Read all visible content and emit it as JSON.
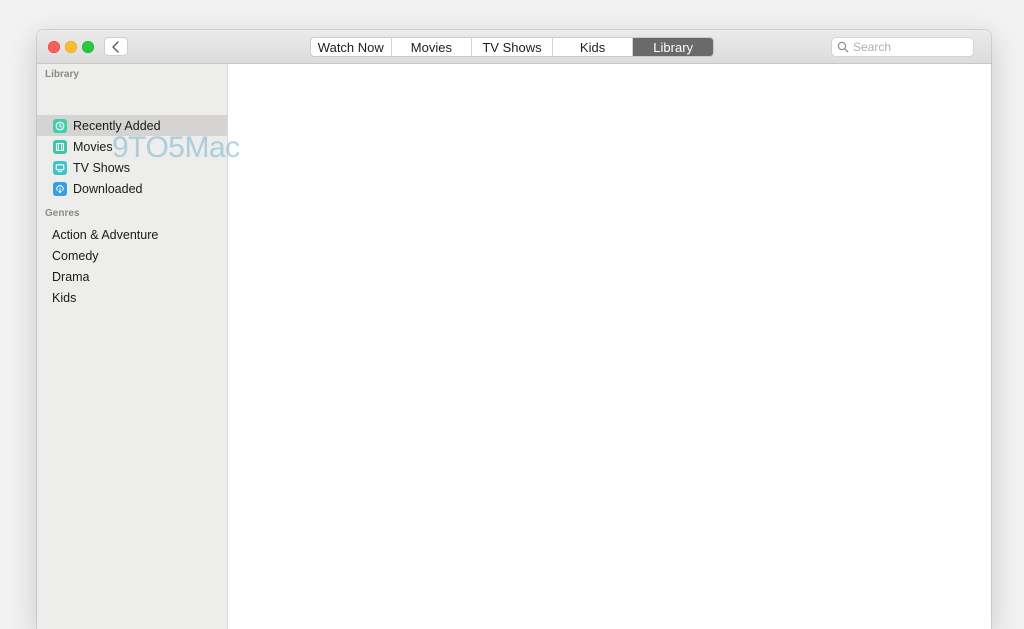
{
  "toolbar": {
    "tabs": [
      {
        "label": "Watch Now"
      },
      {
        "label": "Movies"
      },
      {
        "label": "TV Shows"
      },
      {
        "label": "Kids"
      },
      {
        "label": "Library",
        "active": true
      }
    ],
    "search_placeholder": "Search"
  },
  "sidebar": {
    "library_header": "Library",
    "library_items": [
      {
        "label": "Recently Added",
        "icon": "clock-icon",
        "color": "#3fcfa8",
        "selected": true
      },
      {
        "label": "Movies",
        "icon": "film-icon",
        "color": "#3ec6ab"
      },
      {
        "label": "TV Shows",
        "icon": "tv-icon",
        "color": "#42c2c8"
      },
      {
        "label": "Downloaded",
        "icon": "download-icon",
        "color": "#3a9ee0"
      }
    ],
    "genres_header": "Genres",
    "genre_items": [
      {
        "label": "Action & Adventure"
      },
      {
        "label": "Comedy"
      },
      {
        "label": "Drama"
      },
      {
        "label": "Kids"
      }
    ]
  },
  "watermark": "9TO5Mac",
  "colors": {
    "active_tab": "#6a6a6a",
    "sidebar_bg": "#ededeb",
    "selection_bg": "#d5d4d2"
  }
}
